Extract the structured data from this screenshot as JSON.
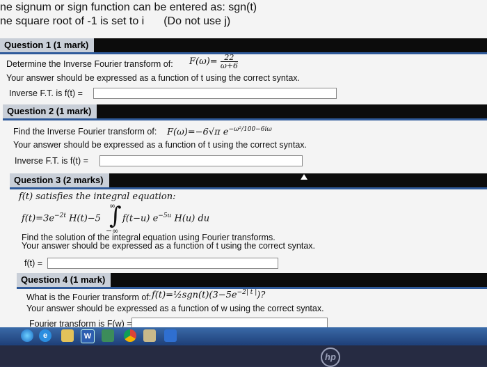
{
  "header": {
    "line1": "ne signum or sign function can be entered as: sgn(t)",
    "line2": "ne square root of -1 is set to i",
    "line2_extra": "(Do not use j)"
  },
  "questions": [
    {
      "label": "Question 1 (1 mark)",
      "prompt": "Determine the Inverse Fourier transform of:",
      "formula_lhs": "F(ω)=",
      "formula_num": "22",
      "formula_den": "ω+6",
      "instruction": "Your answer should be expressed as a function of t using the correct syntax.",
      "answer_label": "Inverse F.T. is f(t) =",
      "answer_value": ""
    },
    {
      "label": "Question 2 (1 mark)",
      "prompt": "Find the Inverse Fourier transform of:",
      "formula": "F(ω)=−6√π e",
      "formula_sup": "−ω²/100−6iω",
      "instruction": "Your answer should be expressed as a function of t using the correct syntax.",
      "answer_label": "Inverse F.T. is f(t) =",
      "answer_value": ""
    },
    {
      "label": "Question 3 (2 marks)",
      "prompt": "f(t) satisfies the integral equation:",
      "formula_left": "f(t)=3e",
      "formula_left_sup": "−2t",
      "formula_left_rest": "H(t)−5",
      "integral_upper": "∞",
      "integral_lower": "−∞",
      "formula_right": "f(t−u) e",
      "formula_right_sup": "−5u",
      "formula_right_rest": "H(u) du",
      "instruction1": "Find the solution of the integral equation using Fourier transforms.",
      "instruction2": "Your answer should be expressed as a function of t using the correct syntax.",
      "answer_label": "f(t) =",
      "answer_value": ""
    },
    {
      "label": "Question 4 (1 mark)",
      "prompt": "What is the Fourier transform of:",
      "formula": "f(t)=½sgn(t)(3−5e",
      "formula_sup": "−2| t |",
      "formula_end": ")?",
      "instruction": "Your answer should be expressed as a function of w using the correct syntax.",
      "answer_label": "Fourier transform is F(w) =",
      "answer_value": ""
    }
  ],
  "taskbar": {
    "icons": [
      "start-orb",
      "ie",
      "explorer",
      "W",
      "photos",
      "chrome",
      "paint",
      "shield"
    ]
  },
  "bezel": {
    "logo": "hp"
  }
}
